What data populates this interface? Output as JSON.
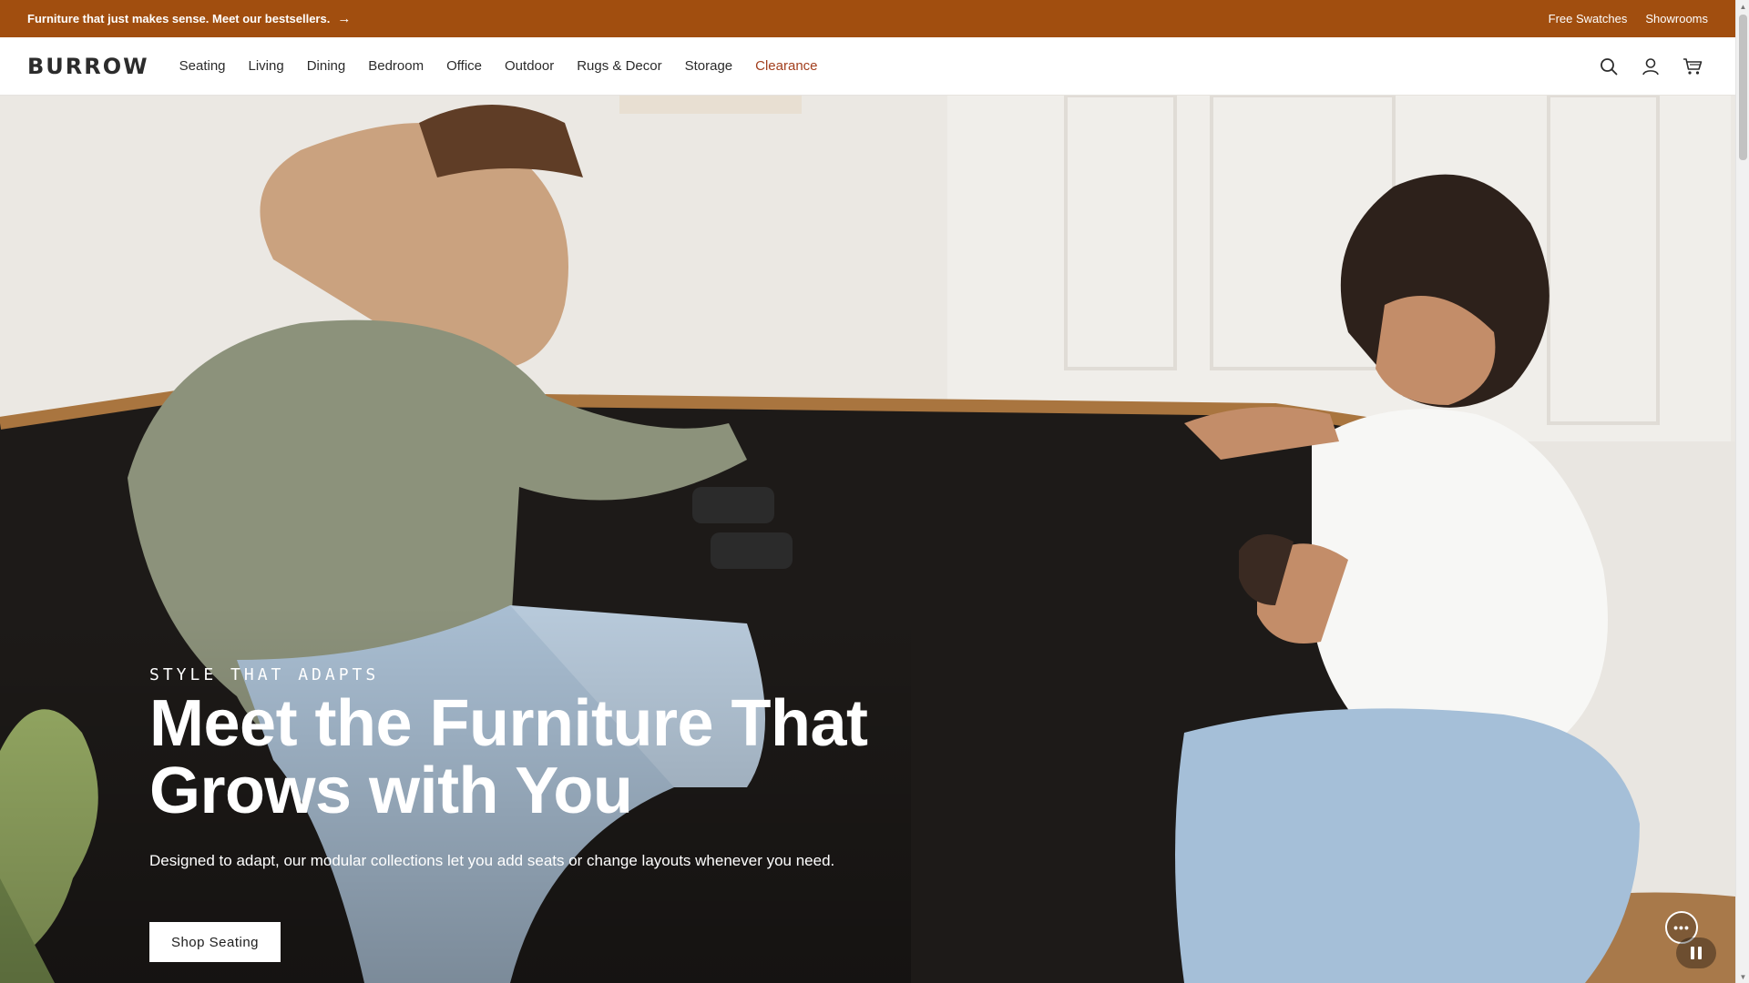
{
  "announcement": {
    "promo_text": "Furniture that just makes sense. Meet our bestsellers.",
    "arrow": "→",
    "links": [
      "Free Swatches",
      "Showrooms"
    ]
  },
  "brand": {
    "logo": "BURROW"
  },
  "nav": {
    "links": [
      "Seating",
      "Living",
      "Dining",
      "Bedroom",
      "Office",
      "Outdoor",
      "Rugs & Decor",
      "Storage",
      "Clearance"
    ],
    "icons": [
      "search-icon",
      "account-icon",
      "cart-icon"
    ]
  },
  "hero": {
    "eyebrow": "STYLE THAT ADAPTS",
    "headline_line1": "Meet the Furniture That",
    "headline_line2": "Grows with You",
    "subline": "Designed to adapt, our modular collections let you add seats or change layouts whenever you need.",
    "cta_label": "Shop Seating",
    "chat_glyph": "•••"
  },
  "colors": {
    "announcement_bg": "#a14e0f",
    "clearance_link": "#a23f1e",
    "cta_bg": "#ffffff"
  }
}
